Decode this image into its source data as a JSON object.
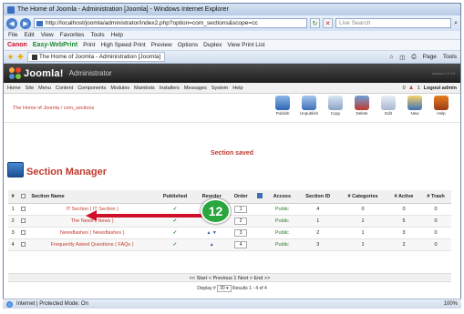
{
  "browser": {
    "title": "The Home of Joomla - Administration [Joomla] - Windows Internet Explorer",
    "url": "http://localhost/joomla/administrator/index2.php?option=com_sections&scope=cc",
    "search_placeholder": "Live Search",
    "menu": [
      "File",
      "Edit",
      "View",
      "Favorites",
      "Tools",
      "Help"
    ],
    "canon_brand": "Canon",
    "canon_product": "Easy-WebPrint",
    "canon_items": [
      "Print",
      "High Speed Print",
      "Preview",
      "Options",
      "Duplex",
      "View Print List"
    ],
    "tab_title": "The Home of Joomla - Administration [Joomla]",
    "tab_tools": [
      "Page",
      "Tools"
    ],
    "status_zone": "Internet | Protected Mode: On",
    "zoom": "100%"
  },
  "joomla": {
    "logo_text": "Joomla!",
    "admin_label": "Administrator",
    "version": "version 1.0.13",
    "menu": [
      "Home",
      "Site",
      "Menu",
      "Content",
      "Components",
      "Modules",
      "Mambots",
      "Installers",
      "Messages",
      "System",
      "Help"
    ],
    "right_items": {
      "count_a": "0",
      "count_b": "1",
      "logout": "Logout admin"
    },
    "breadcrumb": "The Home of Joomla / com_sections",
    "toolbar": [
      "Publish",
      "Unpublish",
      "Copy",
      "Delete",
      "Edit",
      "New",
      "Help"
    ],
    "saved_message": "Section saved",
    "page_title": "Section Manager",
    "columns": [
      "#",
      "",
      "Section Name",
      "Published",
      "Reorder",
      "Order",
      "",
      "Access",
      "Section ID",
      "# Categories",
      "# Active",
      "# Trash"
    ],
    "rows": [
      {
        "num": "1",
        "name": "IT Section ( IT Section )",
        "order": "1",
        "access": "Public",
        "id": "4",
        "cats": "0",
        "active": "0",
        "trash": "0"
      },
      {
        "num": "2",
        "name": "The News ( News )",
        "order": "2",
        "access": "Public",
        "id": "1",
        "cats": "1",
        "active": "5",
        "trash": "0"
      },
      {
        "num": "3",
        "name": "Newsflashes ( Newsflashes )",
        "order": "3",
        "access": "Public",
        "id": "2",
        "cats": "1",
        "active": "3",
        "trash": "0"
      },
      {
        "num": "4",
        "name": "Frequently Asked Questions ( FAQs )",
        "order": "4",
        "access": "Public",
        "id": "3",
        "cats": "1",
        "active": "2",
        "trash": "0"
      }
    ],
    "pager": "<< Start < Previous 1 Next > End >>",
    "display_label": "Display #",
    "display_value": "30",
    "results": "Results 1 - 4 of 4"
  },
  "callout": {
    "number": "12",
    "color": "#2aa63e",
    "arrow_color": "#d0102a"
  }
}
